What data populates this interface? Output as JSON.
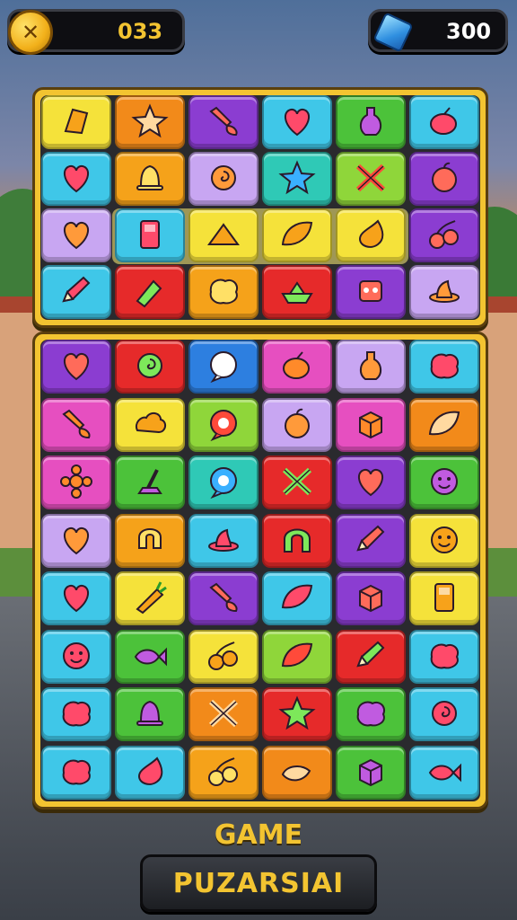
{
  "hud": {
    "coins_value": "033",
    "gems_value": "300",
    "coin_icon": "coin-icon",
    "gem_icon": "gem-icon"
  },
  "footer": {
    "title": "GAME",
    "button_label": "PUZARSIAI"
  },
  "colors": {
    "board_border": "#f3c431",
    "yellow": "#f5e23a",
    "orange": "#f28a1a",
    "purple": "#8b3dd1",
    "cyan": "#3fc7e8",
    "green": "#4cc23a",
    "red": "#e62a2a",
    "lavender": "#c8a6f2",
    "pink": "#e64fc0",
    "blue": "#2d7fe0",
    "teal": "#2fc9b6",
    "amber": "#f5a21a",
    "lime": "#8fd63a"
  },
  "top_grid": [
    [
      "yellow",
      "orange",
      "purple",
      "cyan",
      "green",
      "cyan"
    ],
    [
      "cyan",
      "amber",
      "lavender",
      "teal",
      "lime",
      "purple"
    ],
    [
      "lavender",
      "cyan",
      "yellow",
      "yellow",
      "yellow",
      "purple"
    ],
    [
      "cyan",
      "red",
      "amber",
      "red",
      "purple",
      "lavender"
    ]
  ],
  "top_icons": [
    [
      "note-icon",
      "star-icon",
      "brush-icon",
      "heart-icon",
      "potion-icon",
      "fruit-icon"
    ],
    [
      "heart-icon",
      "bell-icon",
      "swirl-icon",
      "star-icon",
      "crossed-icon",
      "apple-icon"
    ],
    [
      "heart-icon",
      "box-icon",
      "ramp-icon",
      "leaf-icon",
      "drop-icon",
      "cherry-icon"
    ],
    [
      "pencil-icon",
      "bottle-icon",
      "blob-icon",
      "boat-icon",
      "robot-icon",
      "hat-icon"
    ]
  ],
  "bottom_grid": [
    [
      "purple",
      "red",
      "blue",
      "pink",
      "lavender",
      "cyan"
    ],
    [
      "pink",
      "yellow",
      "lime",
      "lavender",
      "pink",
      "orange"
    ],
    [
      "pink",
      "green",
      "teal",
      "red",
      "purple",
      "green"
    ],
    [
      "lavender",
      "amber",
      "cyan",
      "red",
      "purple",
      "yellow"
    ],
    [
      "cyan",
      "yellow",
      "purple",
      "cyan",
      "purple",
      "yellow"
    ],
    [
      "cyan",
      "green",
      "yellow",
      "lime",
      "red",
      "cyan"
    ],
    [
      "cyan",
      "green",
      "orange",
      "red",
      "green",
      "cyan"
    ],
    [
      "cyan",
      "cyan",
      "amber",
      "orange",
      "green",
      "cyan"
    ]
  ],
  "bottom_icons": [
    [
      "heart-icon",
      "swirl-icon",
      "chat-icon",
      "fruit-icon",
      "potion-icon",
      "blob-icon"
    ],
    [
      "brush-icon",
      "cloud-icon",
      "chat-icon",
      "apple-icon",
      "cube-icon",
      "leaf-icon"
    ],
    [
      "flower-icon",
      "shovel-icon",
      "chat-icon",
      "crossed-icon",
      "heart-icon",
      "face-icon"
    ],
    [
      "heart-icon",
      "magnet-icon",
      "hat-icon",
      "arch-icon",
      "pencil-icon",
      "face-icon"
    ],
    [
      "heart-icon",
      "carrot-icon",
      "brush-icon",
      "leaf-icon",
      "cube-icon",
      "box-icon"
    ],
    [
      "face-icon",
      "fish-icon",
      "cherry-icon",
      "leaf-icon",
      "pencil-icon",
      "blob-icon"
    ],
    [
      "blob-icon",
      "bell-icon",
      "crossed-icon",
      "star-icon",
      "blob-icon",
      "swirl-icon"
    ],
    [
      "blob-icon",
      "drop-icon",
      "cherry-icon",
      "pepper-icon",
      "cube-icon",
      "fish-icon"
    ]
  ]
}
